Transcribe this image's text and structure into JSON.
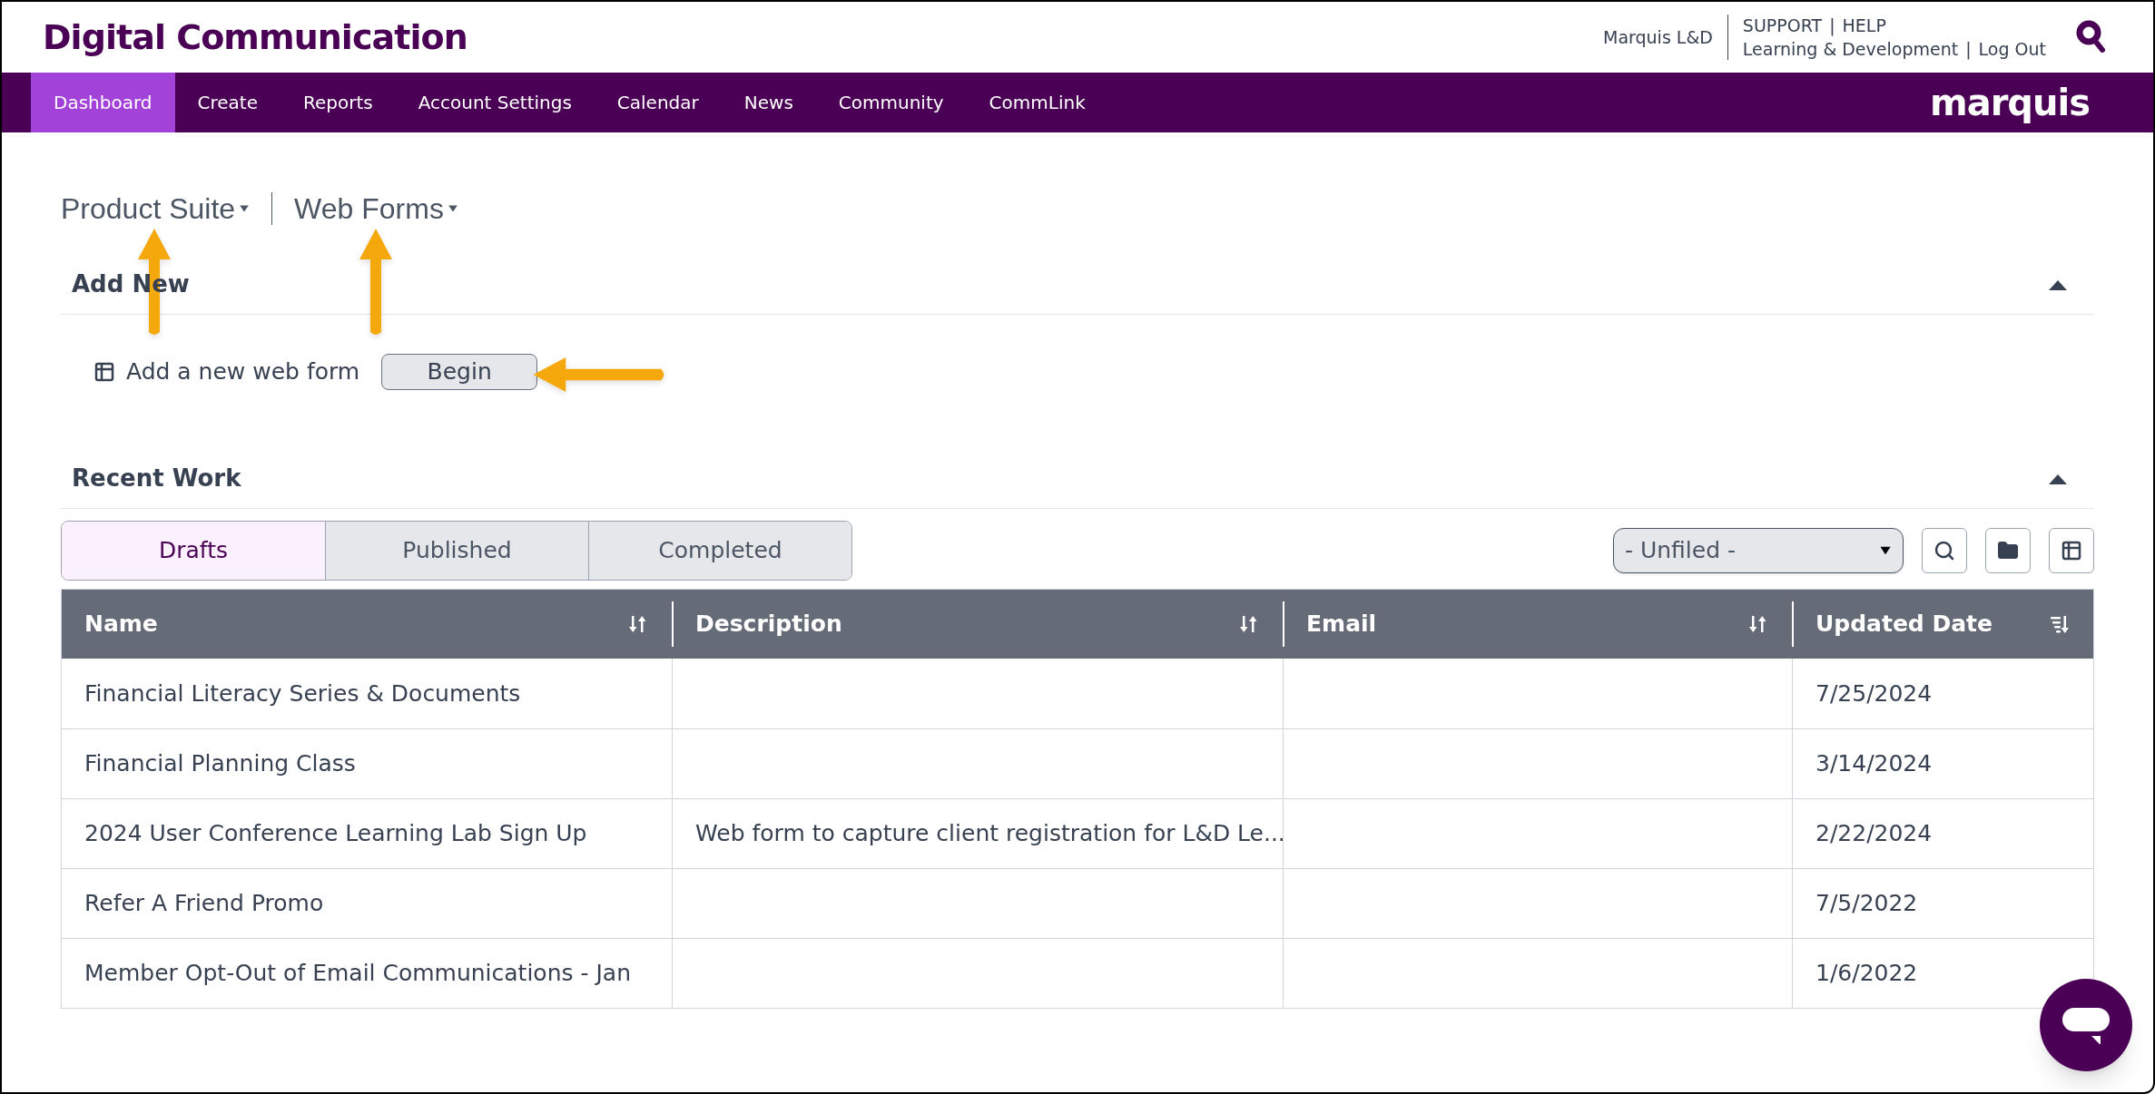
{
  "header": {
    "title": "Digital Communication",
    "account": "Marquis L&D",
    "links_top": [
      "SUPPORT",
      "HELP"
    ],
    "separator": "|",
    "links_bottom": [
      "Learning & Development",
      "Log Out"
    ],
    "logo": "marquis"
  },
  "nav": [
    {
      "label": "Dashboard",
      "selected": true
    },
    {
      "label": "Create",
      "selected": false
    },
    {
      "label": "Reports",
      "selected": false
    },
    {
      "label": "Account Settings",
      "selected": false
    },
    {
      "label": "Calendar",
      "selected": false
    },
    {
      "label": "News",
      "selected": false
    },
    {
      "label": "Community",
      "selected": false
    },
    {
      "label": "CommLink",
      "selected": false
    }
  ],
  "breadcrumb": [
    "Product Suite",
    "Web Forms"
  ],
  "add_new": {
    "title": "Add New",
    "expanded": true,
    "item": "Add a new web form",
    "button": "Begin"
  },
  "recent_work": {
    "title": "Recent Work",
    "expanded": true,
    "tabs": [
      {
        "label": "Drafts",
        "selected": true
      },
      {
        "label": "Published",
        "selected": false
      },
      {
        "label": "Completed",
        "selected": false
      }
    ],
    "folder_select": {
      "value": "- Unfiled -"
    },
    "table": {
      "columns": [
        {
          "label": "Name",
          "sorted": false
        },
        {
          "label": "Description",
          "sorted": false
        },
        {
          "label": "Email",
          "sorted": false
        },
        {
          "label": "Updated Date",
          "sorted": true
        }
      ],
      "rows": [
        [
          "Financial Literacy Series & Documents",
          "",
          "",
          "7/25/2024"
        ],
        [
          "Financial Planning Class",
          "",
          "",
          "3/14/2024"
        ],
        [
          "2024 User Conference Learning Lab Sign Up",
          "Web form to capture client registration for L&D Le...",
          "",
          "2/22/2024"
        ],
        [
          "Refer A Friend Promo",
          "",
          "",
          "7/5/2022"
        ],
        [
          "Member Opt-Out of Email Communications - Jan",
          "",
          "",
          "1/6/2022"
        ]
      ]
    }
  }
}
